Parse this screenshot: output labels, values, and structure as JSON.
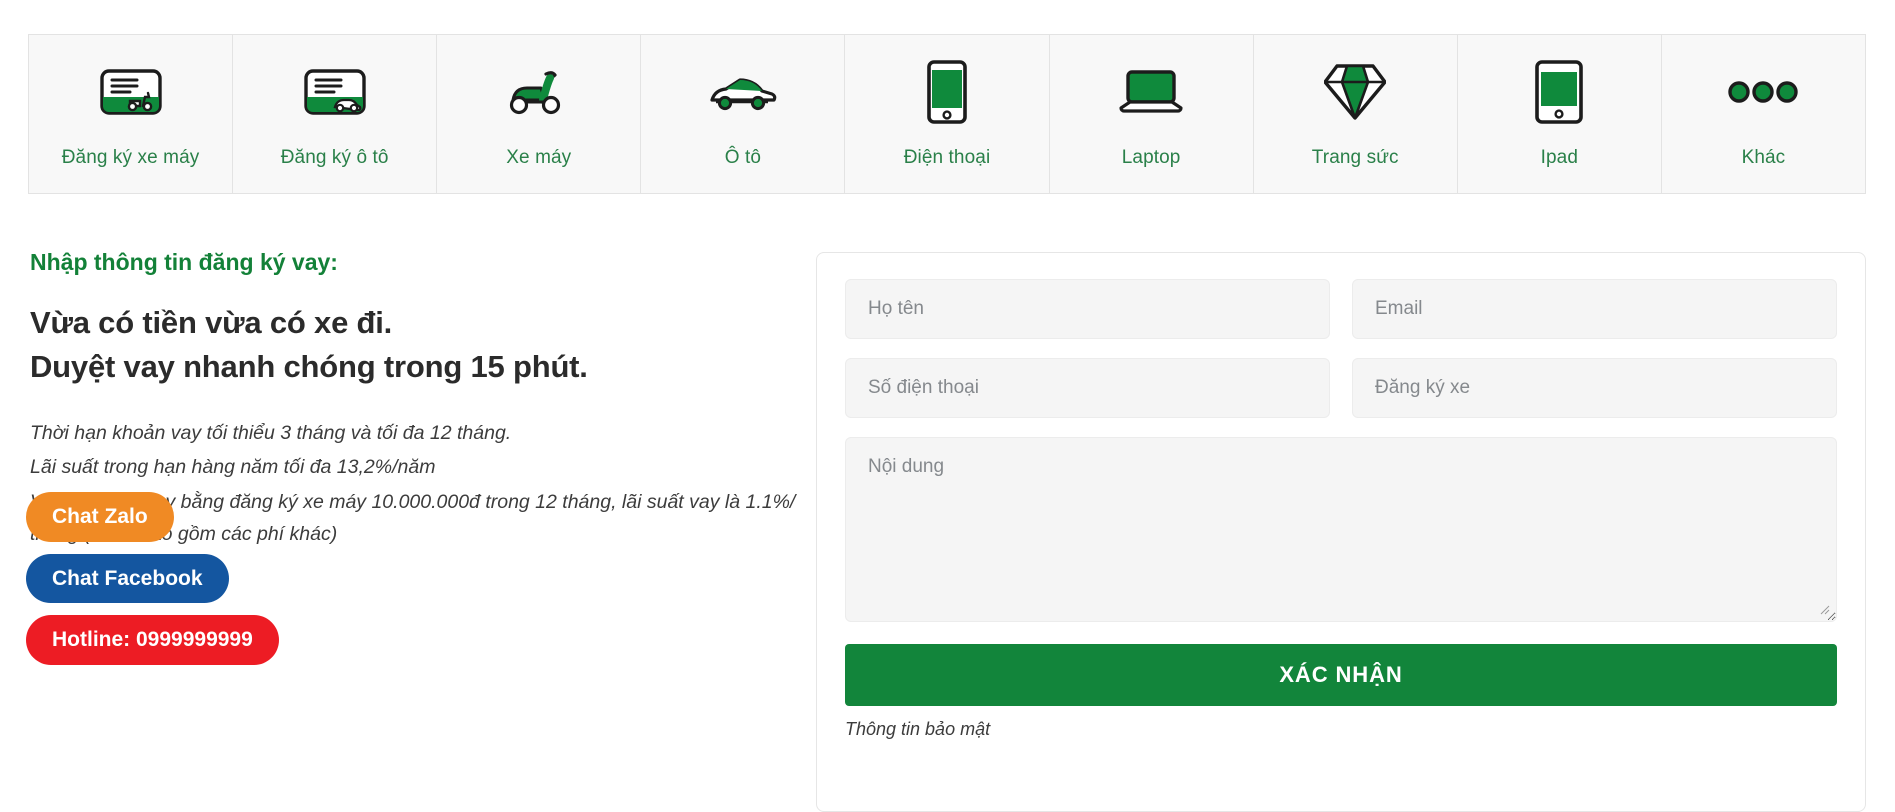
{
  "colors": {
    "brand_green": "#12853b",
    "tab_label_green": "#2a8049",
    "heading_green": "#138138",
    "zalo_orange": "#f08a24",
    "facebook_blue": "#1456a0",
    "hotline_red": "#ed1c24",
    "field_bg": "#f5f5f5",
    "tab_bg": "#f8f8f8"
  },
  "categories": [
    {
      "label": "Đăng ký xe máy",
      "icon": "motorbike-registration-card-icon"
    },
    {
      "label": "Đăng ký ô tô",
      "icon": "car-registration-card-icon"
    },
    {
      "label": "Xe máy",
      "icon": "scooter-icon"
    },
    {
      "label": "Ô tô",
      "icon": "car-icon"
    },
    {
      "label": "Điện thoại",
      "icon": "smartphone-icon"
    },
    {
      "label": "Laptop",
      "icon": "laptop-icon"
    },
    {
      "label": "Trang sức",
      "icon": "diamond-icon"
    },
    {
      "label": "Ipad",
      "icon": "tablet-icon"
    },
    {
      "label": "Khác",
      "icon": "ellipsis-icon"
    }
  ],
  "left": {
    "eyebrow": "Nhập thông tin đăng ký vay:",
    "headline_line1": "Vừa có tiền vừa có xe đi.",
    "headline_line2": "Duyệt vay nhanh chóng trong 15 phút.",
    "terms": [
      "Thời hạn khoản vay tối thiểu 3 tháng và tối đa 12 tháng.",
      "Lãi suất trong hạn hàng năm tối đa 13,2%/năm",
      "Ví dụ: khoản vay bằng đăng ký xe máy 10.000.000đ trong 12 tháng, lãi suất vay là 1.1%/ tháng (chưa bao gồm các phí khác)"
    ]
  },
  "chat": {
    "zalo": "Chat Zalo",
    "facebook": "Chat Facebook",
    "hotline": "Hotline: 0999999999"
  },
  "form": {
    "fields": {
      "fullname_placeholder": "Họ tên",
      "email_placeholder": "Email",
      "phone_placeholder": "Số điện thoại",
      "vehicle_placeholder": "Đăng ký xe",
      "message_placeholder": "Nội dung"
    },
    "submit_label": "XÁC NHẬN",
    "note": "Thông tin bảo mật"
  }
}
